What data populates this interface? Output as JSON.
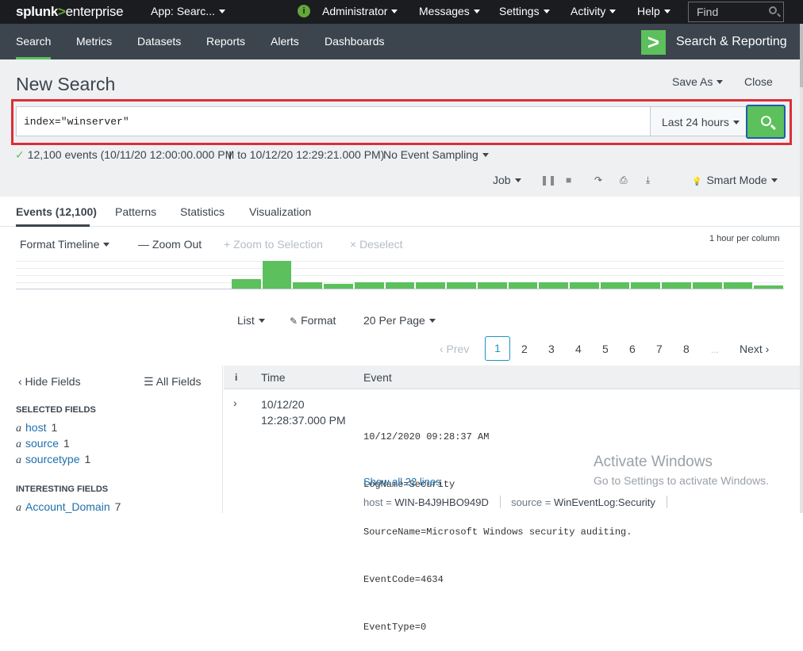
{
  "topbar": {
    "logo_main": "splunk",
    "logo_gt": ">",
    "logo_sub": "enterprise",
    "app_menu": "App: Searc...",
    "info_glyph": "i",
    "administrator": "Administrator",
    "messages": "Messages",
    "settings": "Settings",
    "activity": "Activity",
    "help": "Help",
    "find_placeholder": "Find"
  },
  "appbar": {
    "nav": [
      "Search",
      "Metrics",
      "Datasets",
      "Reports",
      "Alerts",
      "Dashboards"
    ],
    "active_index": 0,
    "app_icon_glyph": ">",
    "app_title": "Search & Reporting"
  },
  "page": {
    "title": "New Search",
    "save_as": "Save As",
    "close": "Close"
  },
  "search": {
    "query": "index=\"winserver\"",
    "time_range": "Last 24 hours",
    "status_check": "✓",
    "status": "12,100 events (10/11/20 12:00:00.000 PM to 10/12/20 12:29:21.000 PM)",
    "sampling": "No Event Sampling"
  },
  "job": {
    "job_label": "Job",
    "mode_label": "Smart Mode",
    "mode_glyph": "💡"
  },
  "tabs": [
    "Events (12,100)",
    "Patterns",
    "Statistics",
    "Visualization"
  ],
  "timeline": {
    "format_label": "Format Timeline",
    "zoom_out": "— Zoom Out",
    "zoom_selection": "+ Zoom to Selection",
    "deselect": "× Deselect",
    "per_column": "1 hour per column",
    "buckets": [
      0,
      0,
      0,
      0,
      0,
      0,
      0,
      6,
      17,
      4,
      3,
      4,
      4,
      4,
      4,
      4,
      4,
      4,
      4,
      4,
      4,
      4,
      4,
      4,
      2
    ],
    "max": 17
  },
  "list_controls": {
    "list": "List",
    "format": "Format",
    "format_glyph": "✎",
    "per_page": "20 Per Page"
  },
  "pagination": {
    "prev": "‹ Prev",
    "current": "1",
    "pages": [
      "2",
      "3",
      "4",
      "5",
      "6",
      "7",
      "8"
    ],
    "ellipsis": "...",
    "next": "Next ›"
  },
  "fields_panel": {
    "hide_fields": "‹ Hide Fields",
    "all_fields": "☰ All Fields",
    "selected_heading": "Selected Fields",
    "type_glyph": "a",
    "selected": [
      {
        "name": "host",
        "count": "1"
      },
      {
        "name": "source",
        "count": "1"
      },
      {
        "name": "sourcetype",
        "count": "1"
      }
    ],
    "interesting_heading": "Interesting Fields",
    "interesting": [
      {
        "name": "Account_Domain",
        "count": "7"
      }
    ]
  },
  "results": {
    "col_info": "i",
    "col_time": "Time",
    "col_event": "Event",
    "expand_glyph": "›",
    "row": {
      "date": "10/12/20",
      "time": "12:28:37.000 PM",
      "event_lines": [
        "10/12/2020 09:28:37 AM",
        "LogName=Security",
        "SourceName=Microsoft Windows security auditing.",
        "EventCode=4634",
        "EventType=0"
      ],
      "show_all": "Show all 22 lines",
      "host_key": "host =",
      "host_val": "WIN-B4J9HBO949D",
      "source_key": "source =",
      "source_val": "WinEventLog:Security"
    }
  },
  "watermark": {
    "line1": "Activate Windows",
    "line2": "Go to Settings to activate Windows."
  },
  "colors": {
    "accent_green": "#5cc05c",
    "highlight_red": "#dc2e38",
    "topbar": "#1a1c20",
    "appbar": "#3c444d"
  }
}
